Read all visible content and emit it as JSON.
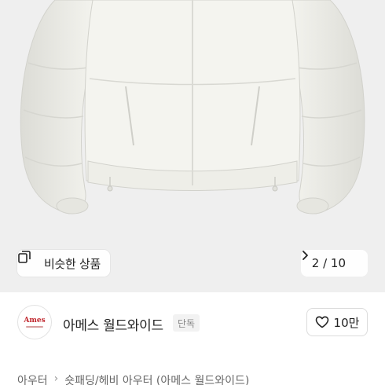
{
  "gallery": {
    "similar_products_label": "비슷한 상품",
    "page_counter": "2 / 10",
    "image_subject": "white-padded-jacket"
  },
  "brand": {
    "logo_text": "Ames",
    "name": "아메스 월드와이드",
    "badge": "단독"
  },
  "like": {
    "count": "10만"
  },
  "breadcrumb": {
    "level1": "아우터",
    "level2": "숏패딩/헤비 아우터 (아메스 월드와이드)"
  },
  "colors": {
    "gallery_bg": "#efefef",
    "jacket": "#f4f4ef",
    "logo_red": "#c0262d"
  }
}
